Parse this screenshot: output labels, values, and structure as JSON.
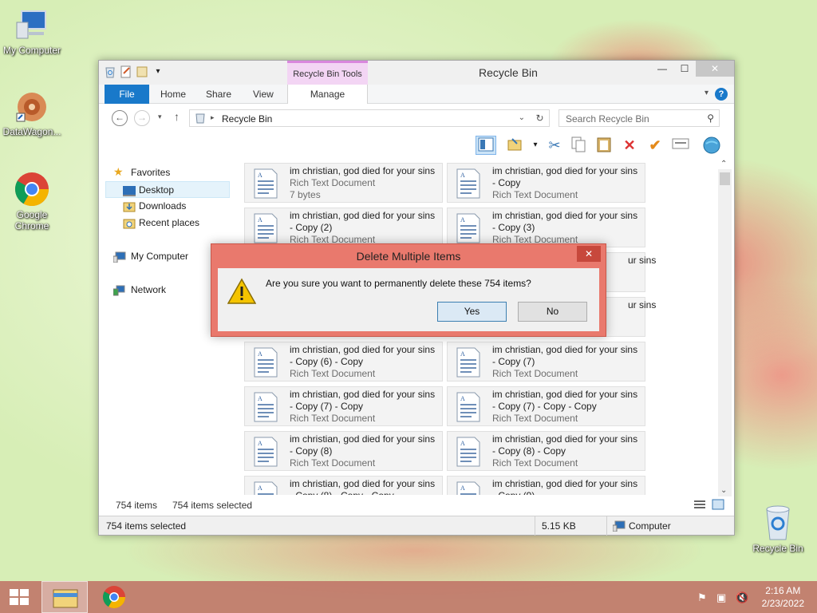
{
  "desktop": {
    "icons": [
      {
        "label": "My Computer",
        "icon": "computer-icon"
      },
      {
        "label": "DataWagon...",
        "icon": "datawagon-icon"
      },
      {
        "label": "Google Chrome",
        "icon": "chrome-icon"
      },
      {
        "label": "Recycle Bin",
        "icon": "recycle-bin-icon"
      }
    ]
  },
  "window": {
    "title": "Recycle Bin",
    "context_tab": "Recycle Bin Tools",
    "ribbon_tabs": [
      "File",
      "Home",
      "Share",
      "View",
      "Manage"
    ],
    "address": "Recycle Bin",
    "search_placeholder": "Search Recycle Bin",
    "help": "?",
    "nav": {
      "favorites": "Favorites",
      "desktop": "Desktop",
      "downloads": "Downloads",
      "recent": "Recent places",
      "computer": "My Computer",
      "network": "Network"
    },
    "files": [
      {
        "l1": "im christian, god died for your sins",
        "l2": "",
        "l3": "Rich Text Document",
        "l3b": "7 bytes"
      },
      {
        "l1": "im christian, god died for your sins",
        "l2": "- Copy",
        "l3": "Rich Text Document"
      },
      {
        "l1": "im christian, god died for your sins",
        "l2": "- Copy (2)",
        "l3": "Rich Text Document"
      },
      {
        "l1": "im christian, god died for your sins",
        "l2": "- Copy (3)",
        "l3": "Rich Text Document"
      },
      {
        "l1": "",
        "l2": "",
        "l3": ""
      },
      {
        "l1": "ur sins",
        "l2": "",
        "l3": ""
      },
      {
        "l1": "",
        "l2": "",
        "l3": ""
      },
      {
        "l1": "ur sins",
        "l2": "",
        "l3": ""
      },
      {
        "l1": "im christian, god died for your sins",
        "l2": "- Copy (6) - Copy",
        "l3": "Rich Text Document"
      },
      {
        "l1": "im christian, god died for your sins",
        "l2": "- Copy (7)",
        "l3": "Rich Text Document"
      },
      {
        "l1": "im christian, god died for your sins",
        "l2": "- Copy (7) - Copy",
        "l3": "Rich Text Document"
      },
      {
        "l1": "im christian, god died for your sins",
        "l2": "- Copy (7) - Copy - Copy",
        "l3": "Rich Text Document"
      },
      {
        "l1": "im christian, god died for your sins",
        "l2": "- Copy (8)",
        "l3": "Rich Text Document"
      },
      {
        "l1": "im christian, god died for your sins",
        "l2": "- Copy (8) - Copy",
        "l3": "Rich Text Document"
      },
      {
        "l1": "im christian, god died for your sins",
        "l2": "- Copy (8) - Copy - Copy",
        "l3": ""
      },
      {
        "l1": "im christian, god died for your sins",
        "l2": "- Copy (9)",
        "l3": ""
      }
    ],
    "status_inner": {
      "count": "754 items",
      "selected": "754 items selected"
    },
    "status_outer": {
      "selected": "754 items selected",
      "size": "5.15 KB",
      "location": "Computer"
    }
  },
  "dialog": {
    "title": "Delete Multiple Items",
    "close": "✕",
    "message": "Are you sure you want to permanently delete these 754 items?",
    "yes": "Yes",
    "no": "No"
  },
  "taskbar": {
    "time": "2:16 AM",
    "date": "2/23/2022"
  },
  "colors": {
    "accent": "#1979ca",
    "dialog_frame": "#e9796d",
    "context_tab": "#f3d5f4"
  }
}
